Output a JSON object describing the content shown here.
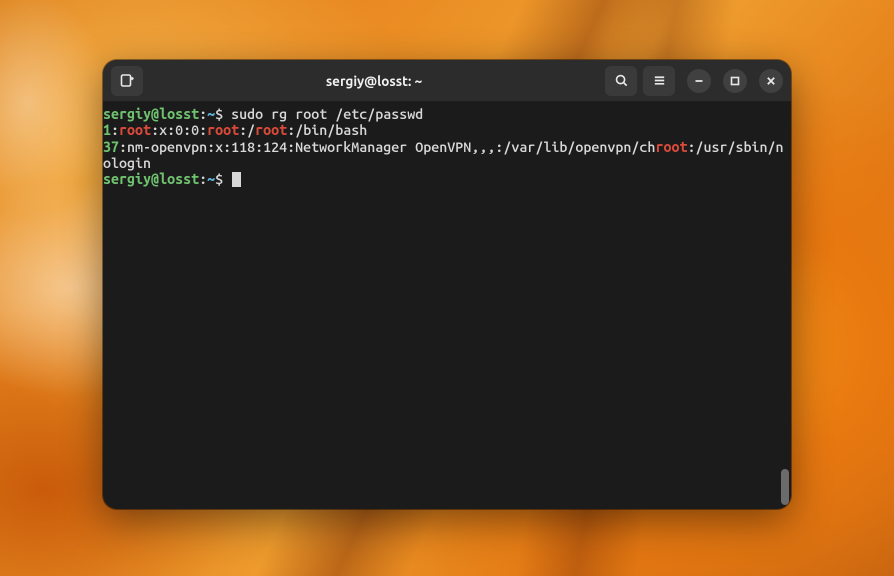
{
  "window": {
    "title": "sergiy@losst: ~"
  },
  "prompt1": {
    "user": "sergiy",
    "at": "@",
    "host": "losst",
    "colon": ":",
    "tilde": "~",
    "dollar": "$ ",
    "command": "sudo rg root /etc/passwd"
  },
  "output": {
    "line1": {
      "lineno": "1",
      "a": ":",
      "m1": "root",
      "b": ":x:0:0:",
      "m2": "root",
      "c": ":/",
      "m3": "root",
      "d": ":/bin/bash"
    },
    "line2": {
      "lineno": "37",
      "a": ":nm-openvpn:x:118:124:NetworkManager OpenVPN,,,:/var/lib/openvpn/ch",
      "m1": "root",
      "b": ":/usr/sbin/nologin"
    }
  },
  "prompt2": {
    "user": "sergiy",
    "at": "@",
    "host": "losst",
    "colon": ":",
    "tilde": "~",
    "dollar": "$ "
  },
  "icons": {
    "newtab": "new-tab-icon",
    "search": "search-icon",
    "menu": "hamburger-menu-icon",
    "min": "minimize-icon",
    "max": "maximize-icon",
    "close": "close-icon"
  }
}
